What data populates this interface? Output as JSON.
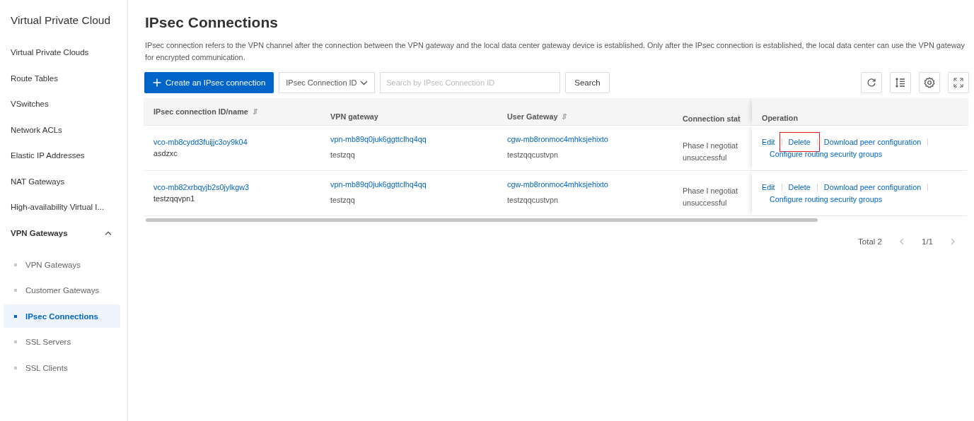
{
  "sidebar": {
    "title": "Virtual Private Cloud",
    "items": [
      {
        "label": "Virtual Private Clouds",
        "selected": false
      },
      {
        "label": "Route Tables",
        "selected": false
      },
      {
        "label": "VSwitches",
        "selected": false
      },
      {
        "label": "Network ACLs",
        "selected": false
      },
      {
        "label": "Elastic IP Addresses",
        "selected": false
      },
      {
        "label": "NAT Gateways",
        "selected": false
      },
      {
        "label": "High-availability Virtual I...",
        "selected": false
      },
      {
        "label": "VPN Gateways",
        "selected": false,
        "expanded": true,
        "children": [
          {
            "label": "VPN Gateways",
            "selected": false
          },
          {
            "label": "Customer Gateways",
            "selected": false
          },
          {
            "label": "IPsec Connections",
            "selected": true
          },
          {
            "label": "SSL Servers",
            "selected": false
          },
          {
            "label": "SSL Clients",
            "selected": false
          }
        ]
      }
    ]
  },
  "page": {
    "title": "IPsec Connections",
    "description": "IPsec connection refers to the VPN channel after the connection between the VPN gateway and the local data center gateway device is established. Only after the IPsec connection is established, the local data center can use the VPN gateway for encrypted communication."
  },
  "toolbar": {
    "create_button": "Create an IPsec connection",
    "filter_select": "IPsec Connection ID",
    "search_field": {
      "placeholder": "Search by IPsec Connection ID"
    },
    "search_button": "Search"
  },
  "table": {
    "columns": [
      {
        "label": "IPsec connection ID/name",
        "sortable": true
      },
      {
        "label": "VPN gateway",
        "sortable": false
      },
      {
        "label": "User Gateway",
        "sortable": true
      },
      {
        "label": "Connection stat",
        "sortable": false
      },
      {
        "label": "Operation",
        "sortable": false
      }
    ],
    "rows": [
      {
        "id": "vco-mb8cydd3fuijjc3oy9k04",
        "name": "asdzxc",
        "vpn_gateway": "vpn-mb89q0juk6ggttclhq4qq",
        "vpn_gateway_name": "testzqq",
        "user_gateway": "cgw-mb8ronmoc4mhksjehixto",
        "user_gateway_name": "testzqqcustvpn",
        "status": [
          "Phase I negotiat",
          "unsuccessful"
        ],
        "operations": [
          {
            "label": "Edit",
            "highlighted": false
          },
          {
            "label": "Delete",
            "highlighted": true
          },
          {
            "label": "Download peer configuration",
            "highlighted": false
          },
          {
            "label": "Configure routing security groups",
            "highlighted": false
          }
        ]
      },
      {
        "id": "vco-mb82xrbqyjb2s0jylkgw3",
        "name": "testzqqvpn1",
        "vpn_gateway": "vpn-mb89q0juk6ggttclhq4qq",
        "vpn_gateway_name": "testzqq",
        "user_gateway": "cgw-mb8ronmoc4mhksjehixto",
        "user_gateway_name": "testzqqcustvpn",
        "status": [
          "Phase I negotiat",
          "unsuccessful"
        ],
        "operations": [
          {
            "label": "Edit",
            "highlighted": false
          },
          {
            "label": "Delete",
            "highlighted": false
          },
          {
            "label": "Download peer configuration",
            "highlighted": false
          },
          {
            "label": "Configure routing security groups",
            "highlighted": false
          }
        ]
      }
    ]
  },
  "pagination": {
    "total": "Total 2",
    "page": "1/1"
  }
}
